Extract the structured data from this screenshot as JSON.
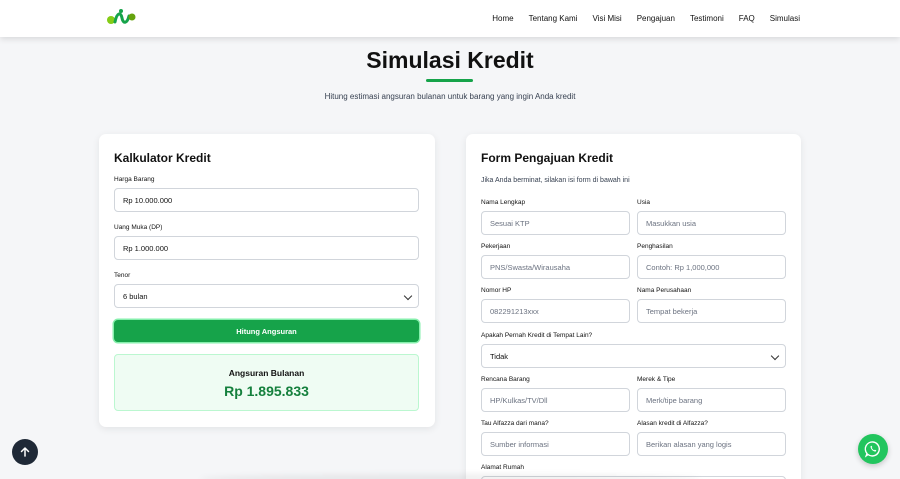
{
  "nav": {
    "items": [
      "Home",
      "Tentang Kami",
      "Visi Misi",
      "Pengajuan",
      "Testimoni",
      "FAQ",
      "Simulasi"
    ]
  },
  "hero": {
    "title": "Simulasi Kredit",
    "subtitle": "Hitung estimasi angsuran bulanan untuk barang yang ingin Anda kredit"
  },
  "calculator": {
    "title": "Kalkulator Kredit",
    "price_label": "Harga Barang",
    "price_value": "Rp 10.000.000",
    "dp_label": "Uang Muka (DP)",
    "dp_value": "Rp 1.000.000",
    "tenor_label": "Tenor",
    "tenor_value": "6 bulan",
    "button": "Hitung Angsuran",
    "result_label": "Angsuran Bulanan",
    "result_value": "Rp 1.895.833"
  },
  "form": {
    "title": "Form Pengajuan Kredit",
    "subtitle": "Jika Anda berminat, silakan isi form di bawah ini",
    "name_label": "Nama Lengkap",
    "name_placeholder": "Sesuai KTP",
    "age_label": "Usia",
    "age_placeholder": "Masukkan usia",
    "job_label": "Pekerjaan",
    "job_placeholder": "PNS/Swasta/Wirausaha",
    "income_label": "Penghasilan",
    "income_placeholder": "Contoh: Rp 1,000,000",
    "phone_label": "Nomor HP",
    "phone_placeholder": "082291213xxx",
    "company_label": "Nama Perusahaan",
    "company_placeholder": "Tempat bekerja",
    "prior_label": "Apakah Pernah Kredit di Tempat Lain?",
    "prior_value": "Tidak",
    "item_label": "Rencana Barang",
    "item_placeholder": "HP/Kulkas/TV/Dll",
    "brand_label": "Merek & Tipe",
    "brand_placeholder": "Merk/tipe barang",
    "source_label": "Tau Alfazza dari mana?",
    "source_placeholder": "Sumber informasi",
    "reason_label": "Alasan kredit di Alfazza?",
    "reason_placeholder": "Berikan alasan yang logis",
    "address_label": "Alamat Rumah"
  },
  "colors": {
    "accent": "#16a34a",
    "result_bg": "#effcf3",
    "whatsapp": "#22c55e",
    "scroll_top": "#1f2937"
  },
  "icons": {
    "logo": "brand-logo",
    "scroll_top": "arrow-up-icon",
    "whatsapp": "whatsapp-icon",
    "select": "chevron-down-icon"
  }
}
